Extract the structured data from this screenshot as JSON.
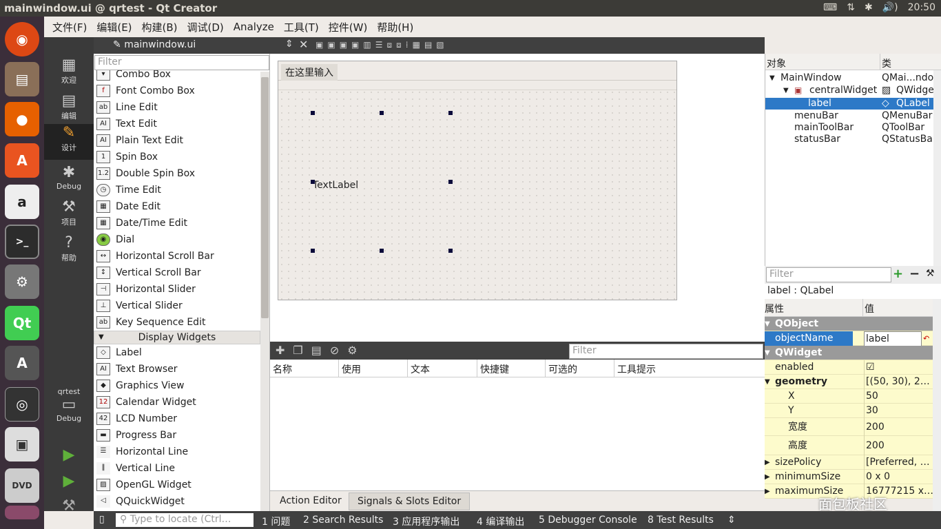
{
  "window_title": "mainwindow.ui @ qrtest - Qt Creator",
  "tray": {
    "time": "20:50",
    "keyboard": "⌨",
    "network": "⇅",
    "bluetooth": "✱",
    "volume": "🔊)"
  },
  "menu": [
    "文件(F)",
    "编辑(E)",
    "构建(B)",
    "调试(D)",
    "Analyze",
    "工具(T)",
    "控件(W)",
    "帮助(H)"
  ],
  "modes": [
    {
      "label": "欢迎",
      "icon": "grid-icon"
    },
    {
      "label": "编辑",
      "icon": "document-icon"
    },
    {
      "label": "设计",
      "icon": "pencil-icon"
    },
    {
      "label": "Debug",
      "icon": "bug-icon"
    },
    {
      "label": "项目",
      "icon": "wrench-icon"
    },
    {
      "label": "帮助",
      "icon": "help-icon"
    }
  ],
  "kit": {
    "project": "qrtest",
    "config": "Debug"
  },
  "editor": {
    "file": "mainwindow.ui"
  },
  "widgetbox": {
    "filter_placeholder": "Filter",
    "items_a": [
      "Combo Box",
      "Font Combo Box",
      "Line Edit",
      "Text Edit",
      "Plain Text Edit",
      "Spin Box",
      "Double Spin Box",
      "Time Edit",
      "Date Edit",
      "Date/Time Edit",
      "Dial",
      "Horizontal Scroll Bar",
      "Vertical Scroll Bar",
      "Horizontal Slider",
      "Vertical Slider",
      "Key Sequence Edit"
    ],
    "category": "Display Widgets",
    "items_b": [
      "Label",
      "Text Browser",
      "Graphics View",
      "Calendar Widget",
      "LCD Number",
      "Progress Bar",
      "Horizontal Line",
      "Vertical Line",
      "OpenGL Widget",
      "QQuickWidget"
    ]
  },
  "form": {
    "menu_item": "在这里输入",
    "label_text": "TextLabel"
  },
  "action_editor": {
    "filter_placeholder": "Filter",
    "columns": [
      "名称",
      "使用",
      "文本",
      "快捷键",
      "可选的",
      "工具提示"
    ]
  },
  "bottom_tabs": [
    "Action Editor",
    "Signals & Slots Editor"
  ],
  "object_inspector": {
    "headers": [
      "对象",
      "类"
    ],
    "rows": [
      {
        "name": "MainWindow",
        "class": "QMai...ndow"
      },
      {
        "name": "centralWidget",
        "class": "QWidget"
      },
      {
        "name": "label",
        "class": "QLabel"
      },
      {
        "name": "menuBar",
        "class": "QMenuBar"
      },
      {
        "name": "mainToolBar",
        "class": "QToolBar"
      },
      {
        "name": "statusBar",
        "class": "QStatusBar"
      }
    ]
  },
  "property_editor": {
    "filter_placeholder": "Filter",
    "title": "label : QLabel",
    "headers": [
      "属性",
      "值"
    ],
    "rows": [
      {
        "k": "QObject",
        "v": "",
        "group": true
      },
      {
        "k": "objectName",
        "v": "label"
      },
      {
        "k": "QWidget",
        "v": "",
        "group": true
      },
      {
        "k": "enabled",
        "v": "☑"
      },
      {
        "k": "geometry",
        "v": "[(50, 30), 2…"
      },
      {
        "k": "X",
        "v": "50"
      },
      {
        "k": "Y",
        "v": "30"
      },
      {
        "k": "宽度",
        "v": "200"
      },
      {
        "k": "高度",
        "v": "200"
      },
      {
        "k": "sizePolicy",
        "v": "[Preferred, …"
      },
      {
        "k": "minimumSize",
        "v": "0 x 0"
      },
      {
        "k": "maximumSize",
        "v": "16777215 x…"
      }
    ]
  },
  "status": {
    "locator_placeholder": "Type to locate (Ctrl…",
    "panes": [
      "1 问题",
      "2 Search Results",
      "3 应用程序输出",
      "4 编译输出",
      "5 Debugger Console",
      "8 Test Results"
    ]
  },
  "watermark": "面包板社区"
}
